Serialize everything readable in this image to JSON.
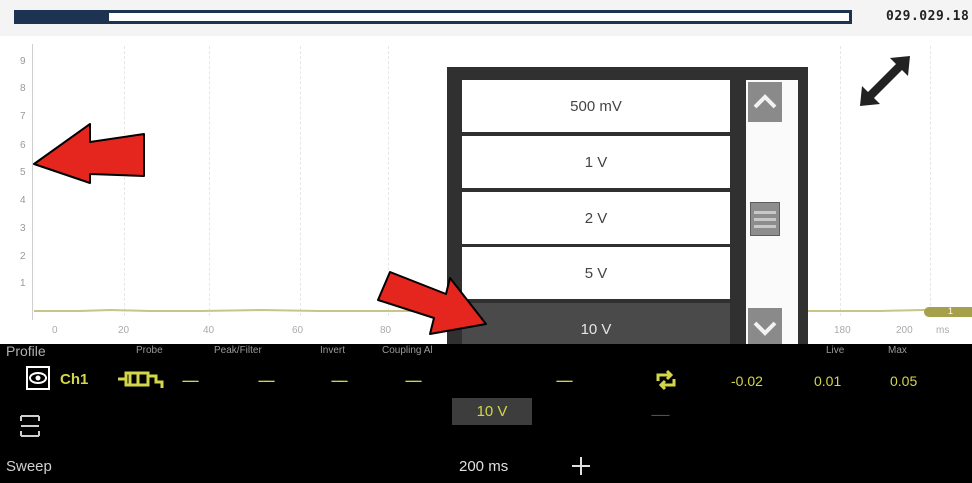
{
  "top_bar": {
    "file_id": "029.029.18",
    "buffer_fill_fraction": 0.11
  },
  "graph": {
    "y_ticks": [
      "9",
      "8",
      "7",
      "6",
      "5",
      "4",
      "3",
      "2",
      "1"
    ],
    "x_ticks": [
      "0",
      "20",
      "40",
      "60",
      "80",
      "180",
      "200"
    ],
    "x_unit": "ms",
    "trigger_label": "1",
    "trace_color": "#c9c487"
  },
  "scale_dropdown": {
    "options": [
      "500 mV",
      "1 V",
      "2 V",
      "5 V",
      "10 V"
    ],
    "selected": "10 V"
  },
  "panel": {
    "headers": {
      "profile": "Profile",
      "probe": "Probe",
      "peak_filter": "Peak/Filter",
      "invert": "Invert",
      "coupling": "Coupling Al",
      "live": "Live",
      "max": "Max"
    },
    "channel": {
      "name": "Ch1",
      "probe": "------",
      "peak_filter": "------",
      "invert": "------",
      "coupling": "------",
      "scale": "10 V",
      "position": "------",
      "min_value": "-0.02",
      "live_value": "0.01",
      "max_value": "0.05",
      "sub_dash": "---------"
    },
    "sweep": {
      "label": "Sweep",
      "value": "200 ms"
    }
  },
  "colors": {
    "accent": "#d3d64a",
    "annotation_arrow": "#e5261e",
    "header_bar": "#1c3352"
  }
}
